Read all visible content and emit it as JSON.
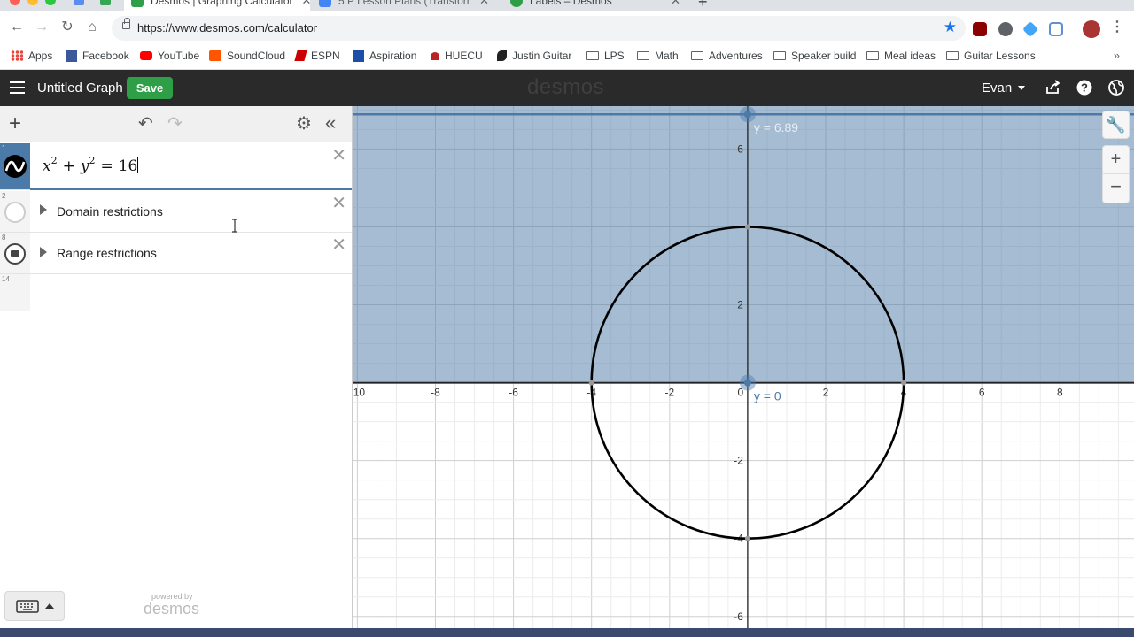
{
  "browser": {
    "tabs": [
      {
        "title": "Desmos | Graphing Calculator",
        "active": true
      },
      {
        "title": "5.P Lesson Plans (Transformati",
        "active": false
      },
      {
        "title": "Labels – Desmos",
        "active": false
      }
    ],
    "url": "https://www.desmos.com/calculator",
    "bookmarks": [
      {
        "label": "Apps",
        "icon": "apps-grid-icon"
      },
      {
        "label": "Facebook",
        "icon": "facebook-icon"
      },
      {
        "label": "YouTube",
        "icon": "youtube-icon"
      },
      {
        "label": "SoundCloud",
        "icon": "soundcloud-icon"
      },
      {
        "label": "ESPN",
        "icon": "espn-icon"
      },
      {
        "label": "Aspiration",
        "icon": "aspiration-icon"
      },
      {
        "label": "HUECU",
        "icon": "huecu-icon"
      },
      {
        "label": "Justin Guitar",
        "icon": "justin-guitar-icon"
      },
      {
        "label": "LPS",
        "icon": "folder-icon"
      },
      {
        "label": "Math",
        "icon": "folder-icon"
      },
      {
        "label": "Adventures",
        "icon": "folder-icon"
      },
      {
        "label": "Speaker build",
        "icon": "folder-icon"
      },
      {
        "label": "Meal ideas",
        "icon": "folder-icon"
      },
      {
        "label": "Guitar Lessons",
        "icon": "folder-icon"
      }
    ],
    "more": "»"
  },
  "header": {
    "graph_title": "Untitled Graph",
    "save_label": "Save",
    "brand": "desmos",
    "user": "Evan"
  },
  "expressions": [
    {
      "number": "1",
      "type": "expression",
      "latex": "x^2+y^2=16",
      "parts": {
        "x": "x",
        "two": "2",
        "plus": "+",
        "y": "y",
        "eq": "=",
        "rhs": "16"
      }
    },
    {
      "number": "2",
      "type": "folder",
      "label": "Domain restrictions"
    },
    {
      "number": "8",
      "type": "folder",
      "label": "Range restrictions"
    },
    {
      "number": "14",
      "type": "empty"
    }
  ],
  "footer": {
    "powered_by": "powered by",
    "logo": "desmos"
  },
  "graph": {
    "x_range": [
      -10.1,
      9.9
    ],
    "y_range": [
      -6.3,
      7.1
    ],
    "x_ticks": [
      "-10",
      "-8",
      "-6",
      "-4",
      "-2",
      "0",
      "2",
      "4",
      "6",
      "8"
    ],
    "y_ticks": [
      "6",
      "2",
      "-2",
      "-4",
      "-6"
    ],
    "circle": {
      "cx": 0,
      "cy": 0,
      "r": 4,
      "color": "#000000"
    },
    "shaded_region": {
      "y_min": 0,
      "y_max": 6.89,
      "color": "#4b7aa8"
    },
    "labels": [
      {
        "text": "y = 6.89",
        "x": 0,
        "y": 6.89
      },
      {
        "text": "y = 0",
        "x": 0,
        "y": 0
      }
    ],
    "points_color": "#999999",
    "accent": "#4b7aa8"
  },
  "chart_data": {
    "type": "scatter",
    "title": "",
    "xlabel": "",
    "ylabel": "",
    "xlim": [
      -10.1,
      9.9
    ],
    "ylim": [
      -6.3,
      7.1
    ],
    "series": [
      {
        "name": "x^2+y^2=16",
        "x": [
          -4,
          0,
          4,
          0
        ],
        "y": [
          0,
          4,
          0,
          -4
        ]
      }
    ],
    "grid": true
  }
}
